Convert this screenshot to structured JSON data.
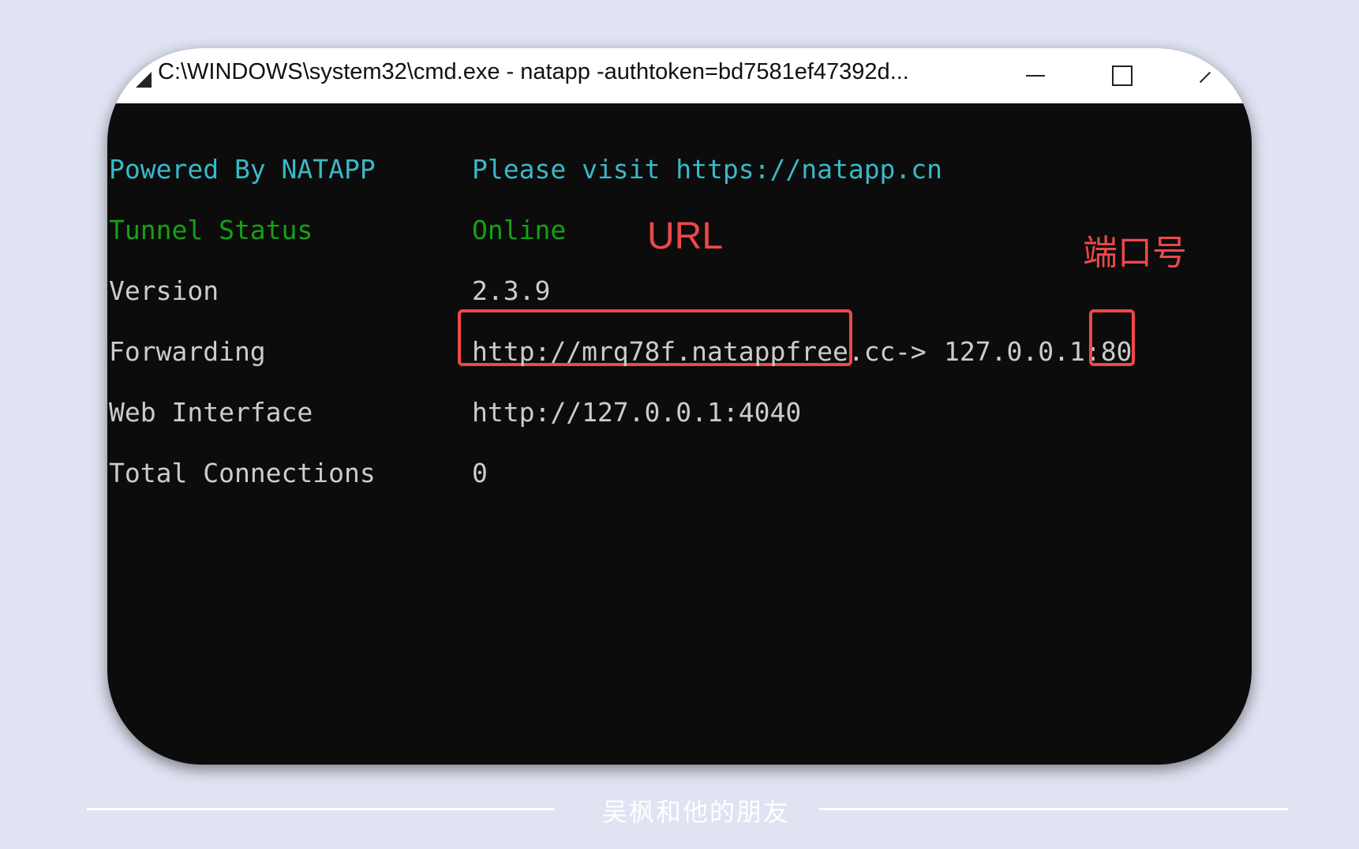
{
  "window": {
    "title": "C:\\WINDOWS\\system32\\cmd.exe - natapp  -authtoken=bd7581ef47392d..."
  },
  "console": {
    "rows": [
      {
        "label": "Powered By NATAPP",
        "value": "Please visit https://natapp.cn",
        "color": "#3ab8c8"
      },
      {
        "label": "Tunnel Status",
        "value": "Online",
        "color": "#16a016"
      },
      {
        "label": "Version",
        "value": "2.3.9",
        "color": "#cccccc"
      },
      {
        "label": "Forwarding",
        "value": "http://mrq78f.natappfree.cc",
        "color": "#cccccc"
      },
      {
        "label": "Web Interface",
        "value": "http://127.0.0.1:4040",
        "color": "#cccccc"
      },
      {
        "label": "Total Connections",
        "value": "0",
        "color": "#cccccc"
      }
    ],
    "forwarding_arrow": "->",
    "forwarding_local": "127.0.0.1:",
    "forwarding_port": "80"
  },
  "annotations": {
    "url_label": "URL",
    "port_label": "端口号",
    "color": "#ee4848"
  },
  "footer": {
    "text": "吴枫和他的朋友"
  },
  "icons": {
    "title": "console-app-icon",
    "minimize": "minimize-icon",
    "maximize": "maximize-icon",
    "close": "close-icon"
  }
}
